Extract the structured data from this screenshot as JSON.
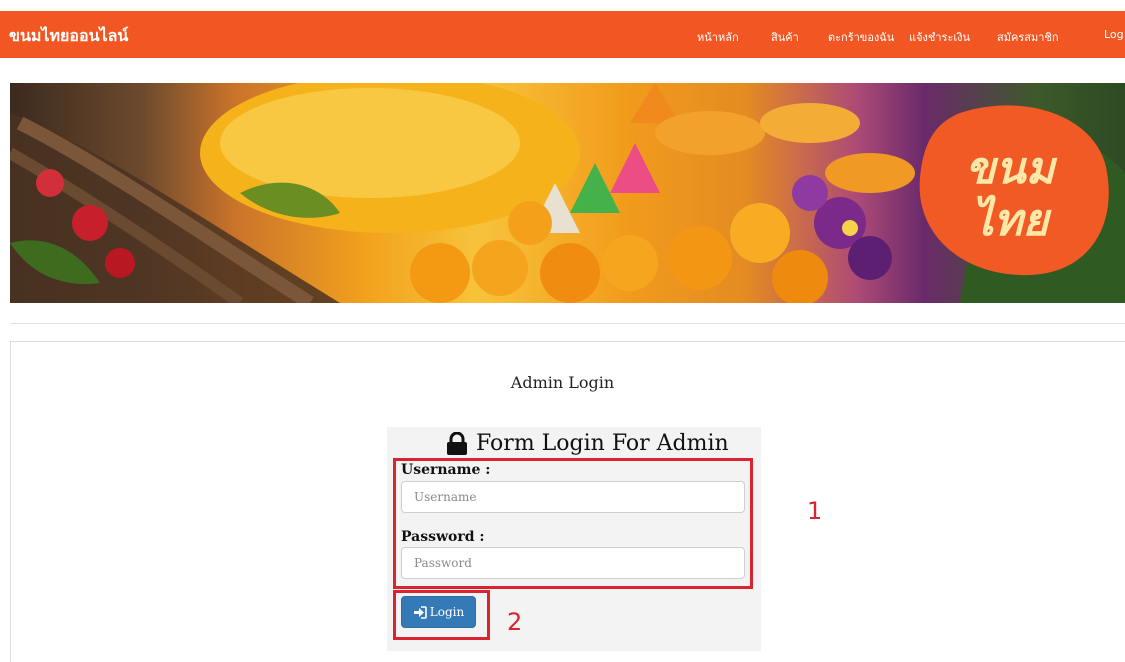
{
  "navbar": {
    "brand": "ขนมไทยออนไลน์",
    "items": [
      {
        "label": "หน้าหลัก"
      },
      {
        "label": "สินค้า"
      },
      {
        "label": "ตะกร้าของฉัน"
      },
      {
        "label": "แจ้งชำระเงิน"
      },
      {
        "label": "สมัครสมาชิก"
      },
      {
        "label": "Log"
      }
    ],
    "color": "#f15623"
  },
  "banner": {
    "logo_line1": "ขนม",
    "logo_line2": "ไทย",
    "logo_color": "#f15a24"
  },
  "page": {
    "title": "Admin Login"
  },
  "form": {
    "heading": "Form Login For Admin",
    "heading_icon": "lock-icon",
    "username_label": "Username :",
    "username_placeholder": "Username",
    "username_value": "",
    "password_label": "Password :",
    "password_placeholder": "Password",
    "password_value": "",
    "login_label": "Login",
    "login_icon": "sign-in-icon",
    "button_color": "#337ab7"
  },
  "annotations": {
    "one": "1",
    "two": "2",
    "color": "#d9232e"
  }
}
